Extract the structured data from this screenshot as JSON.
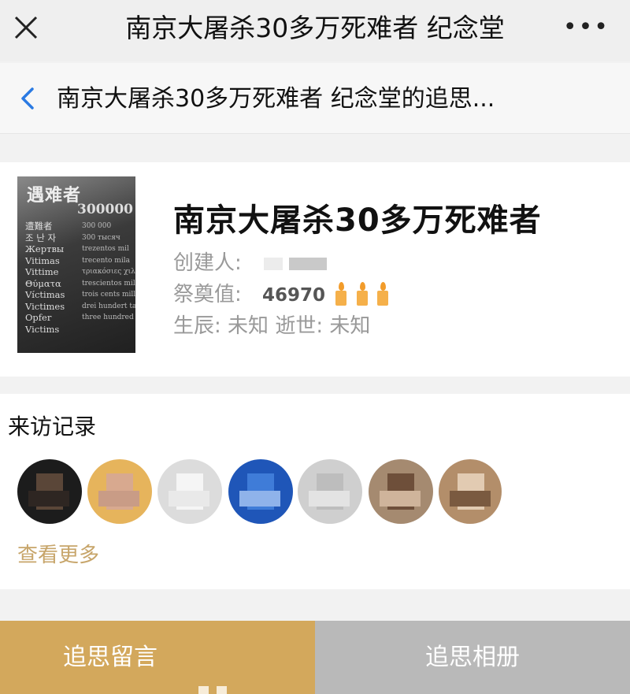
{
  "topbar": {
    "title": "南京大屠杀30多万死难者 纪念堂",
    "more": "•••"
  },
  "navbar": {
    "title": "南京大屠杀30多万死难者 纪念堂的追思..."
  },
  "profile": {
    "photo_text": {
      "heading": "遇难者",
      "number": "300000",
      "words": [
        "遭難者",
        "조 난 자",
        "Жертвы",
        "Vitimas",
        "Vittime",
        "Θύματα",
        "Víctimas",
        "Victimes",
        "Opfer",
        "Victims"
      ],
      "numbers": [
        "300 000",
        "300 тысяч",
        "trezentos mil",
        "trecento mila",
        "τριακόσιες χιλιάδες",
        "trescientos mil",
        "trois cents mille",
        "drei hundert tausend",
        "three hundred thousand"
      ]
    },
    "name": "南京大屠杀30多万死难者",
    "creator_label": "创建人:",
    "tribute_label": "祭奠值:",
    "tribute_value": "46970",
    "birth_label": "生辰:",
    "birth_value": "未知",
    "death_label": "逝世:",
    "death_value": "未知"
  },
  "visits": {
    "label": "来访记录",
    "more": "查看更多",
    "avatar_count": 7
  },
  "bottom": {
    "left_label": "追思留言",
    "right_label": "追思相册"
  },
  "colors": {
    "accent_gold": "#d3a85c",
    "link_gold": "#c7a56a",
    "back_blue": "#2a7ae2",
    "disabled_gray": "#b9b9b9"
  }
}
